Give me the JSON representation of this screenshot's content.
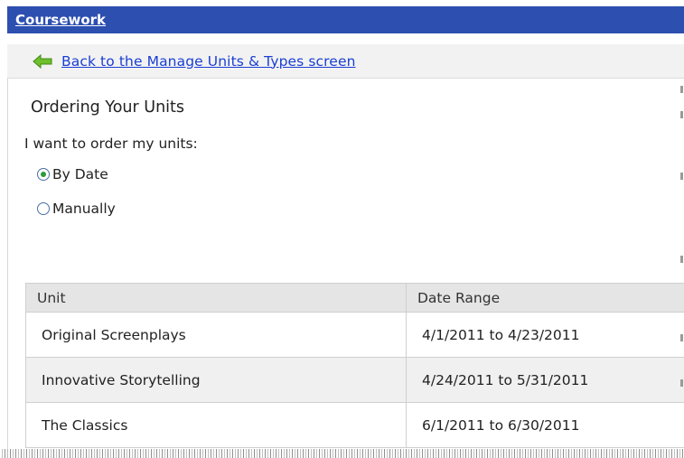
{
  "header": {
    "title": "Coursework"
  },
  "back": {
    "icon": "left-arrow-icon",
    "label": "Back to the Manage Units & Types screen"
  },
  "ordering": {
    "title": "Ordering Your Units",
    "prompt": "I want to order my units:",
    "options": [
      {
        "label": "By Date",
        "selected": true
      },
      {
        "label": "Manually",
        "selected": false
      }
    ]
  },
  "table": {
    "headers": [
      "Unit",
      "Date Range"
    ],
    "rows": [
      {
        "unit": "Original Screenplays",
        "range": "4/1/2011 to 4/23/2011"
      },
      {
        "unit": "Innovative Storytelling",
        "range": "4/24/2011 to 5/31/2011"
      },
      {
        "unit": "The Classics",
        "range": "6/1/2011 to 6/30/2011"
      }
    ]
  },
  "colors": {
    "header_bg": "#2d4fb0",
    "link": "#1a3fd4",
    "back_arrow": "#6fbf2e",
    "radio_selected": "#2b9a3a"
  }
}
